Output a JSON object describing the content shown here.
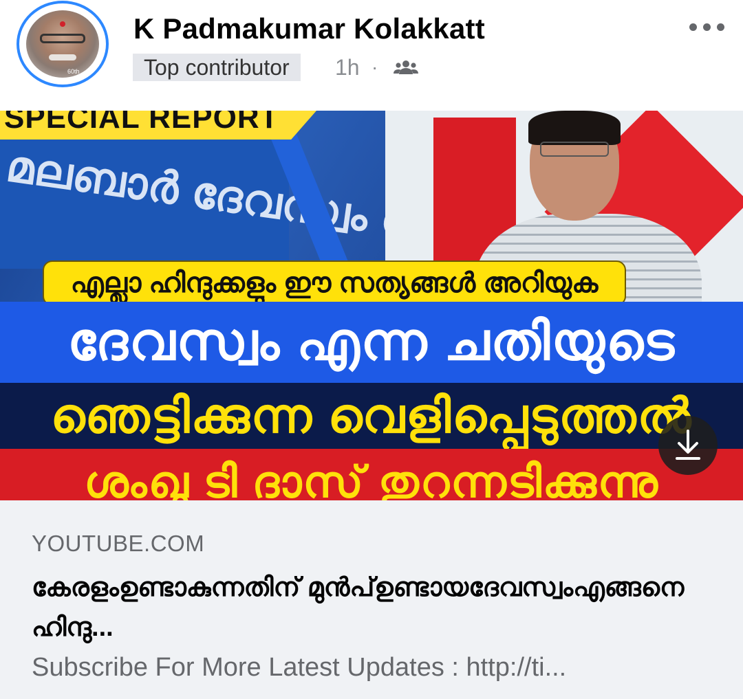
{
  "post": {
    "author_name": "K Padmakumar Kolakkatt",
    "author_badge": "Top contributor",
    "time": "1h",
    "separator": "·",
    "audience_icon": "friends-icon",
    "more_icon": "more-options-icon",
    "avatar_tag": "60th"
  },
  "thumbnail": {
    "corner_label": "SPECIAL REPORT",
    "sign_text": "മലബാർ ദേവസ്വം ബോർഡ്",
    "banner_text": "എല്ലാ ഹിന്ദുക്കളും ഈ സത്യങ്ങൾ അറിയുക",
    "line1": "ദേവസ്വം എന്ന ചതിയുടെ",
    "line2": "ഞെട്ടിക്കുന്ന വെളിപ്പെടുത്തൽ",
    "line3": "ശംഖു ടി ദാസ് തുറന്നടിക്കുന്നു",
    "download_icon": "download-icon"
  },
  "link_card": {
    "domain": "YOUTUBE.COM",
    "title": "കേരളംഉണ്ടാകുന്നതിന് മുൻപ്ഉണ്ടായദേവസ്വംഎങ്ങനെ ഹിന്ദു...",
    "description": "Subscribe For More Latest Updates : http://ti..."
  },
  "colors": {
    "accent_blue": "#2d88ff",
    "banner_blue": "#1e5ae6",
    "banner_yellow": "#ffe10a",
    "banner_red": "#d81d24"
  }
}
